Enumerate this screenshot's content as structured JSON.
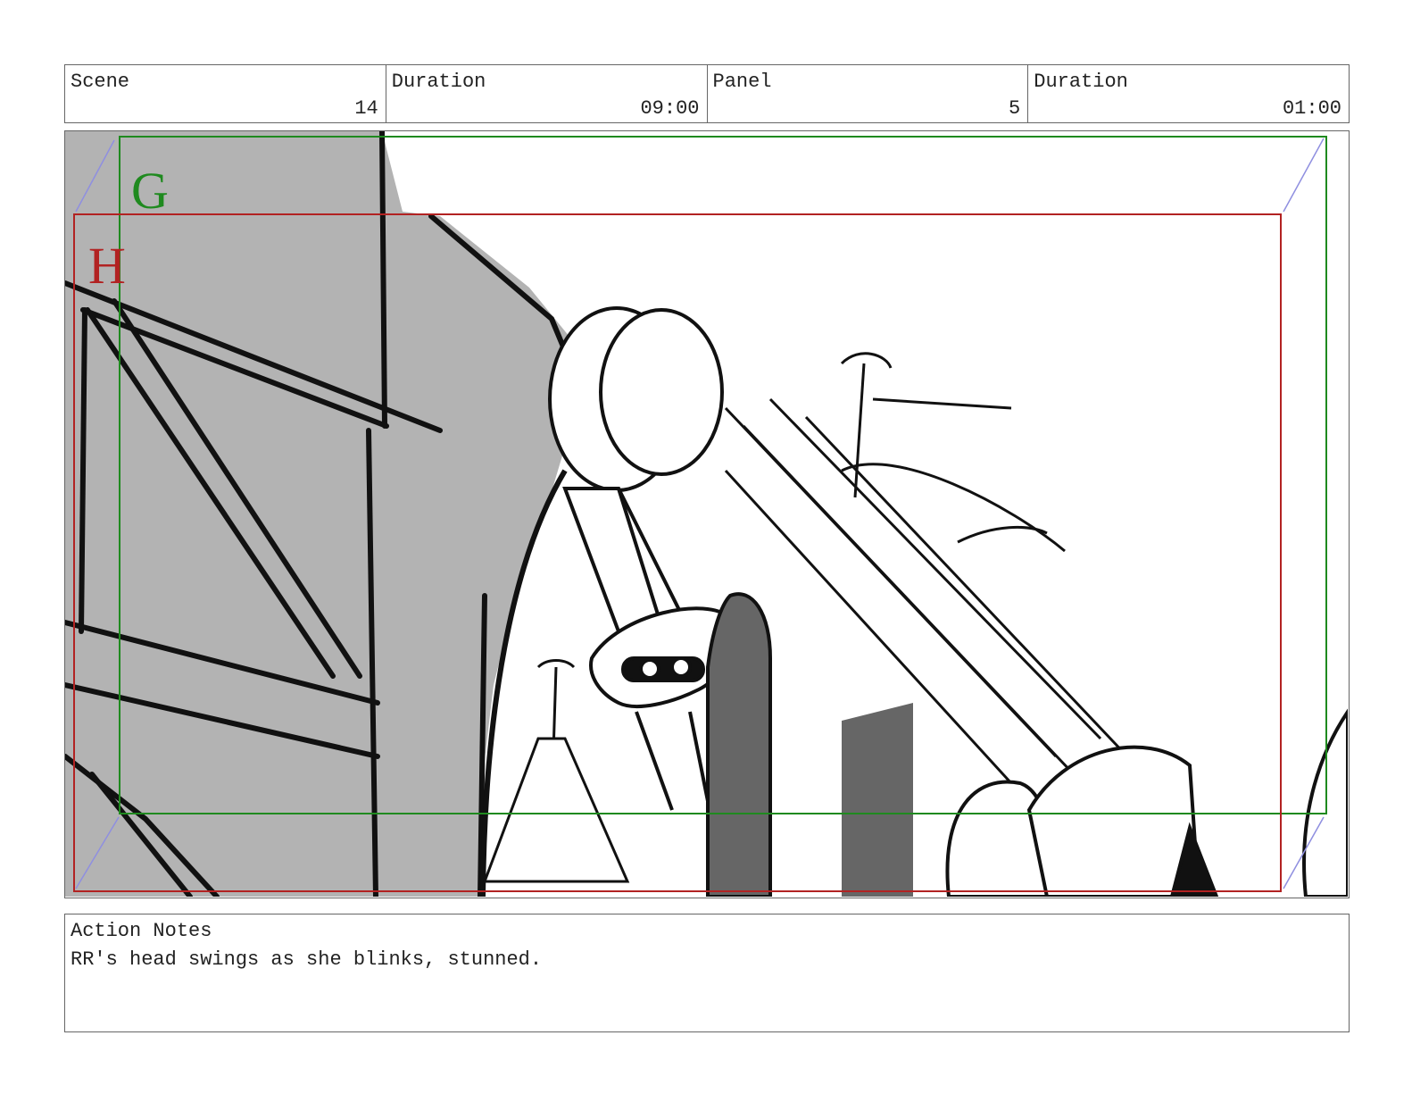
{
  "header": {
    "scene_label": "Scene",
    "scene_value": "14",
    "scene_duration_label": "Duration",
    "scene_duration_value": "09:00",
    "panel_label": "Panel",
    "panel_value": "5",
    "panel_duration_label": "Duration",
    "panel_duration_value": "01:00"
  },
  "frame": {
    "guide_g_letter": "G",
    "guide_h_letter": "H",
    "guide_g_color": "#1f8a1f",
    "guide_h_color": "#b22222",
    "sketch_fill_color": "#b3b3b3",
    "dark_fill_color": "#666666"
  },
  "notes": {
    "label": "Action Notes",
    "text": "RR's head swings as she blinks, stunned."
  }
}
